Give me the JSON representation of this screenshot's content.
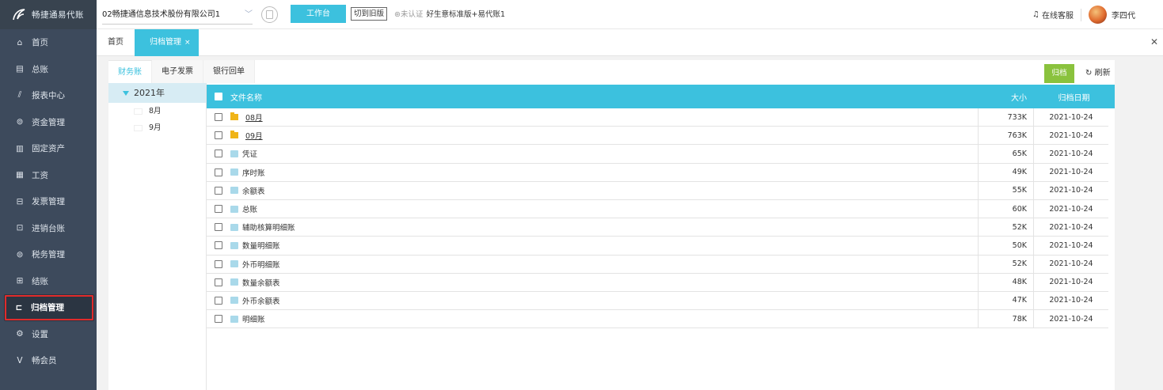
{
  "logo": {
    "text": "畅捷通易代账"
  },
  "sidebar": {
    "items": [
      {
        "label": "首页",
        "icon": "home-icon"
      },
      {
        "label": "总账",
        "icon": "ledger-icon"
      },
      {
        "label": "报表中心",
        "icon": "chart-icon"
      },
      {
        "label": "资金管理",
        "icon": "money-bag-icon"
      },
      {
        "label": "固定资产",
        "icon": "asset-icon"
      },
      {
        "label": "工资",
        "icon": "salary-icon"
      },
      {
        "label": "发票管理",
        "icon": "invoice-icon"
      },
      {
        "label": "进销台账",
        "icon": "inventory-icon"
      },
      {
        "label": "税务管理",
        "icon": "tax-icon"
      },
      {
        "label": "结账",
        "icon": "checkout-icon"
      },
      {
        "label": "归档管理",
        "icon": "archive-icon",
        "active": true
      },
      {
        "label": "设置",
        "icon": "gear-icon"
      },
      {
        "label": "畅会员",
        "icon": "vip-icon"
      }
    ]
  },
  "topbar": {
    "company": "02畅捷通信息技术股份有限公司1",
    "workbench_label": "工作台",
    "old_version_label": "切到旧版",
    "cert_status": "未认证",
    "edition": "好生意标准版+易代账1",
    "online_service": "在线客服",
    "user_name": "李四代"
  },
  "tabs": {
    "home": "首页",
    "archive": "归档管理",
    "close": "×",
    "close_all": "✕"
  },
  "subtabs": [
    "财务账",
    "电子发票",
    "银行回单"
  ],
  "toolbar": {
    "archive_label": "归档",
    "refresh_label": "刷新"
  },
  "tree": {
    "year": "2021年",
    "months": [
      "8月",
      "9月"
    ]
  },
  "table": {
    "headers": {
      "name": "文件名称",
      "size": "大小",
      "date": "归档日期"
    },
    "rows": [
      {
        "name": "08月",
        "size": "733K",
        "date": "2021-10-24",
        "type": "folder"
      },
      {
        "name": "09月",
        "size": "763K",
        "date": "2021-10-24",
        "type": "folder"
      },
      {
        "name": "凭证",
        "size": "65K",
        "date": "2021-10-24",
        "type": "file"
      },
      {
        "name": "序时账",
        "size": "49K",
        "date": "2021-10-24",
        "type": "file"
      },
      {
        "name": "余额表",
        "size": "55K",
        "date": "2021-10-24",
        "type": "file"
      },
      {
        "name": "总账",
        "size": "60K",
        "date": "2021-10-24",
        "type": "file"
      },
      {
        "name": "辅助核算明细账",
        "size": "52K",
        "date": "2021-10-24",
        "type": "file"
      },
      {
        "name": "数量明细账",
        "size": "50K",
        "date": "2021-10-24",
        "type": "file"
      },
      {
        "name": "外币明细账",
        "size": "52K",
        "date": "2021-10-24",
        "type": "file"
      },
      {
        "name": "数量余额表",
        "size": "48K",
        "date": "2021-10-24",
        "type": "file"
      },
      {
        "name": "外币余额表",
        "size": "47K",
        "date": "2021-10-24",
        "type": "file"
      },
      {
        "name": "明细账",
        "size": "78K",
        "date": "2021-10-24",
        "type": "file"
      }
    ]
  }
}
